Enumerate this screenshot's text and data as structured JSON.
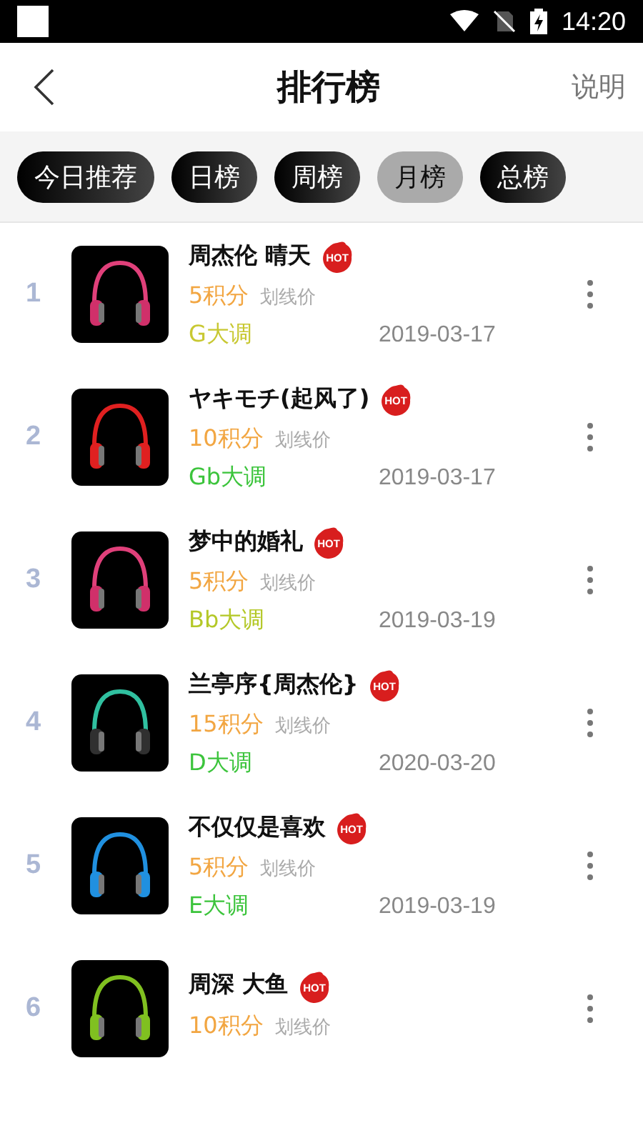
{
  "status_bar": {
    "time": "14:20"
  },
  "header": {
    "title": "排行榜",
    "action": "说明"
  },
  "tabs": [
    {
      "label": "今日推荐",
      "selected": false
    },
    {
      "label": "日榜",
      "selected": false
    },
    {
      "label": "周榜",
      "selected": false
    },
    {
      "label": "月榜",
      "selected": true
    },
    {
      "label": "总榜",
      "selected": false
    }
  ],
  "songs": [
    {
      "rank": "1",
      "title": "周杰伦 晴天",
      "badge": "HOT",
      "points": "5积分",
      "list_price": "划线价",
      "key": "G大调",
      "color": "#c8c832",
      "date": "2019-03-17"
    },
    {
      "rank": "2",
      "title": "ヤキモチ(起风了)",
      "badge": "HOT",
      "points": "10积分",
      "list_price": "划线价",
      "key": "Gb大调",
      "color": "#3cc43c",
      "date": "2019-03-17"
    },
    {
      "rank": "3",
      "title": "梦中的婚礼",
      "badge": "HOT",
      "points": "5积分",
      "list_price": "划线价",
      "key": "Bb大调",
      "color": "#b4c828",
      "date": "2019-03-19"
    },
    {
      "rank": "4",
      "title": "兰亭序{周杰伦}",
      "badge": "HOT",
      "points": "15积分",
      "list_price": "划线价",
      "key": "D大调",
      "color": "#3cc43c",
      "date": "2020-03-20"
    },
    {
      "rank": "5",
      "title": "不仅仅是喜欢",
      "badge": "HOT",
      "points": "5积分",
      "list_price": "划线价",
      "key": "E大调",
      "color": "#3cc43c",
      "date": "2019-03-19"
    },
    {
      "rank": "6",
      "title": "周深 大鱼",
      "badge": "HOT",
      "points": "10积分",
      "list_price": "划线价"
    }
  ]
}
